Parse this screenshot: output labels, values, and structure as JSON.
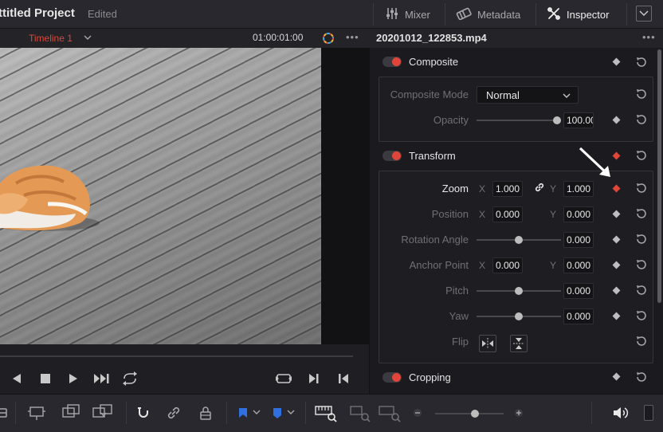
{
  "header": {
    "project_title": "ttitled Project",
    "project_status": "Edited",
    "mixer_label": "Mixer",
    "metadata_label": "Metadata",
    "inspector_label": "Inspector"
  },
  "viewer": {
    "timeline_name": "Timeline 1",
    "timecode": "01:00:01:00",
    "more": "•••"
  },
  "inspector": {
    "clip_name": "20201012_122853.mp4",
    "more": "•••",
    "composite": {
      "title": "Composite",
      "mode_label": "Composite Mode",
      "mode_value": "Normal",
      "opacity_label": "Opacity",
      "opacity_value": "100.00",
      "opacity_fraction": 1.0
    },
    "transform": {
      "title": "Transform",
      "zoom_label": "Zoom",
      "zoom_x": "1.000",
      "zoom_y": "1.000",
      "position_label": "Position",
      "position_x": "0.000",
      "position_y": "0.000",
      "rotation_label": "Rotation Angle",
      "rotation_value": "0.000",
      "anchor_label": "Anchor Point",
      "anchor_x": "0.000",
      "anchor_y": "0.000",
      "pitch_label": "Pitch",
      "pitch_value": "0.000",
      "yaw_label": "Yaw",
      "yaw_value": "0.000",
      "flip_label": "Flip",
      "x_axis": "X",
      "y_axis": "Y"
    },
    "cropping": {
      "title": "Cropping"
    }
  },
  "colors": {
    "accent_red": "#e0453a",
    "timeline_red": "#d44a3c"
  }
}
